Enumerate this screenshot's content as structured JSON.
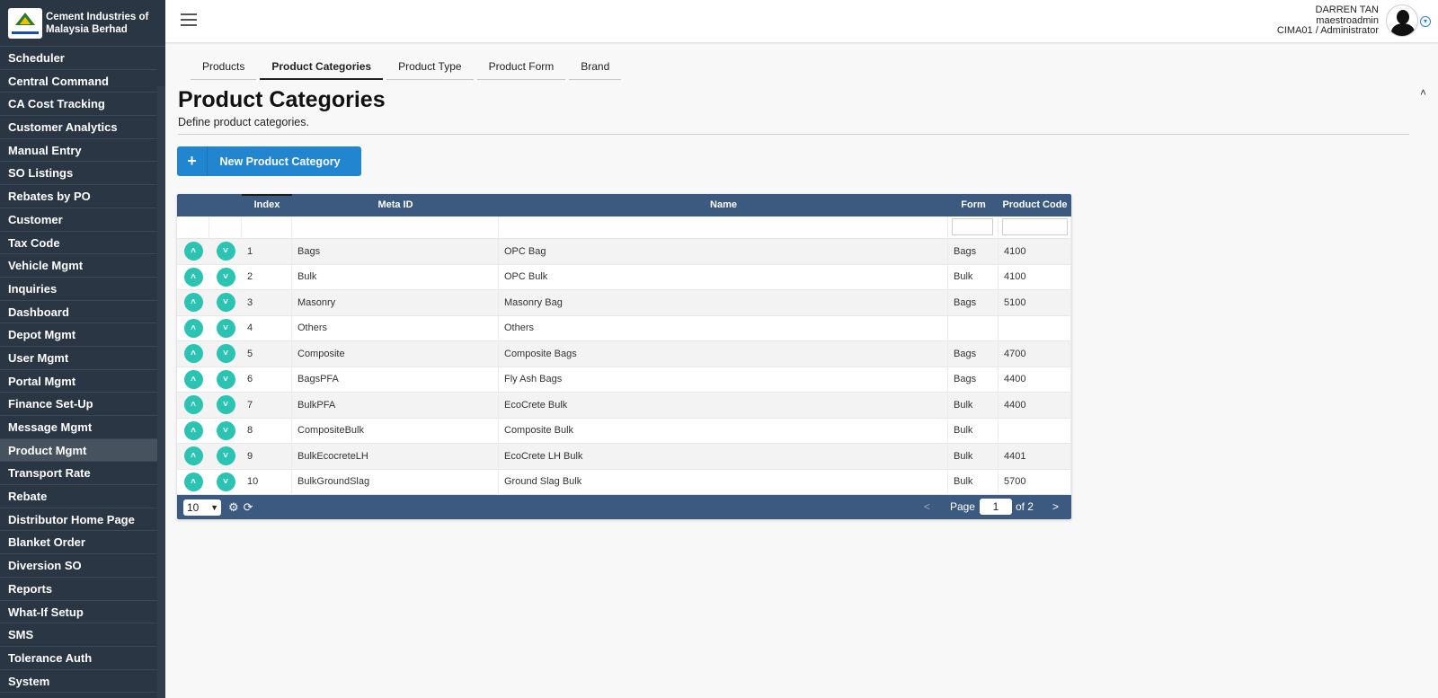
{
  "brand": {
    "name_line1": "Cement Industries of",
    "name_line2": "Malaysia Berhad"
  },
  "sidebar": {
    "items": [
      {
        "label": "Scheduler"
      },
      {
        "label": "Central Command"
      },
      {
        "label": "CA Cost Tracking"
      },
      {
        "label": "Customer Analytics"
      },
      {
        "label": "Manual Entry"
      },
      {
        "label": "SO Listings"
      },
      {
        "label": "Rebates by PO"
      },
      {
        "label": "Customer"
      },
      {
        "label": "Tax Code"
      },
      {
        "label": "Vehicle Mgmt"
      },
      {
        "label": "Inquiries"
      },
      {
        "label": "Dashboard"
      },
      {
        "label": "Depot Mgmt"
      },
      {
        "label": "User Mgmt"
      },
      {
        "label": "Portal Mgmt"
      },
      {
        "label": "Finance Set-Up"
      },
      {
        "label": "Message Mgmt"
      },
      {
        "label": "Product Mgmt"
      },
      {
        "label": "Transport Rate"
      },
      {
        "label": "Rebate"
      },
      {
        "label": "Distributor Home Page"
      },
      {
        "label": "Blanket Order"
      },
      {
        "label": "Diversion SO"
      },
      {
        "label": "Reports"
      },
      {
        "label": "What-If Setup"
      },
      {
        "label": "SMS"
      },
      {
        "label": "Tolerance Auth"
      },
      {
        "label": "System"
      }
    ],
    "active_index": 17
  },
  "header": {
    "user_name": "DARREN TAN",
    "user_login": "maestroadmin",
    "user_role": "CIMA01 / Administrator"
  },
  "tabs": [
    {
      "label": "Products"
    },
    {
      "label": "Product Categories"
    },
    {
      "label": "Product Type"
    },
    {
      "label": "Product Form"
    },
    {
      "label": "Brand"
    }
  ],
  "page": {
    "title": "Product Categories",
    "subtitle": "Define product categories.",
    "new_button_label": "New Product Category"
  },
  "grid": {
    "columns": {
      "index": "Index",
      "meta_id": "Meta ID",
      "name": "Name",
      "form": "Form",
      "product_code": "Product Code"
    },
    "rows": [
      {
        "index": "1",
        "meta_id": "Bags",
        "name": "OPC Bag",
        "form": "Bags",
        "product_code": "4100"
      },
      {
        "index": "2",
        "meta_id": "Bulk",
        "name": "OPC Bulk",
        "form": "Bulk",
        "product_code": "4100"
      },
      {
        "index": "3",
        "meta_id": "Masonry",
        "name": "Masonry Bag",
        "form": "Bags",
        "product_code": "5100"
      },
      {
        "index": "4",
        "meta_id": "Others",
        "name": "Others",
        "form": "",
        "product_code": ""
      },
      {
        "index": "5",
        "meta_id": "Composite",
        "name": "Composite Bags",
        "form": "Bags",
        "product_code": "4700"
      },
      {
        "index": "6",
        "meta_id": "BagsPFA",
        "name": "Fly Ash Bags",
        "form": "Bags",
        "product_code": "4400"
      },
      {
        "index": "7",
        "meta_id": "BulkPFA",
        "name": "EcoCrete Bulk",
        "form": "Bulk",
        "product_code": "4400"
      },
      {
        "index": "8",
        "meta_id": "CompositeBulk",
        "name": "Composite Bulk",
        "form": "Bulk",
        "product_code": ""
      },
      {
        "index": "9",
        "meta_id": "BulkEcocreteLH",
        "name": "EcoCrete LH Bulk",
        "form": "Bulk",
        "product_code": "4401"
      },
      {
        "index": "10",
        "meta_id": "BulkGroundSlag",
        "name": "Ground Slag Bulk",
        "form": "Bulk",
        "product_code": "5700"
      }
    ],
    "footer": {
      "page_size": "10",
      "page_label": "Page",
      "current_page": "1",
      "of_label": "of 2",
      "prev": "<",
      "next": ">"
    }
  },
  "icons": {
    "menu": "menu-icon",
    "avatar": "user-avatar-icon",
    "up": "chevron-up-icon",
    "down": "chevron-down-icon",
    "settings": "gear-icon",
    "refresh": "refresh-icon",
    "plus": "plus-icon"
  },
  "colors": {
    "sidebar_bg": "#2b3645",
    "grid_header": "#3c5a80",
    "primary_button": "#2185d0",
    "row_action": "#2bc4b3"
  }
}
